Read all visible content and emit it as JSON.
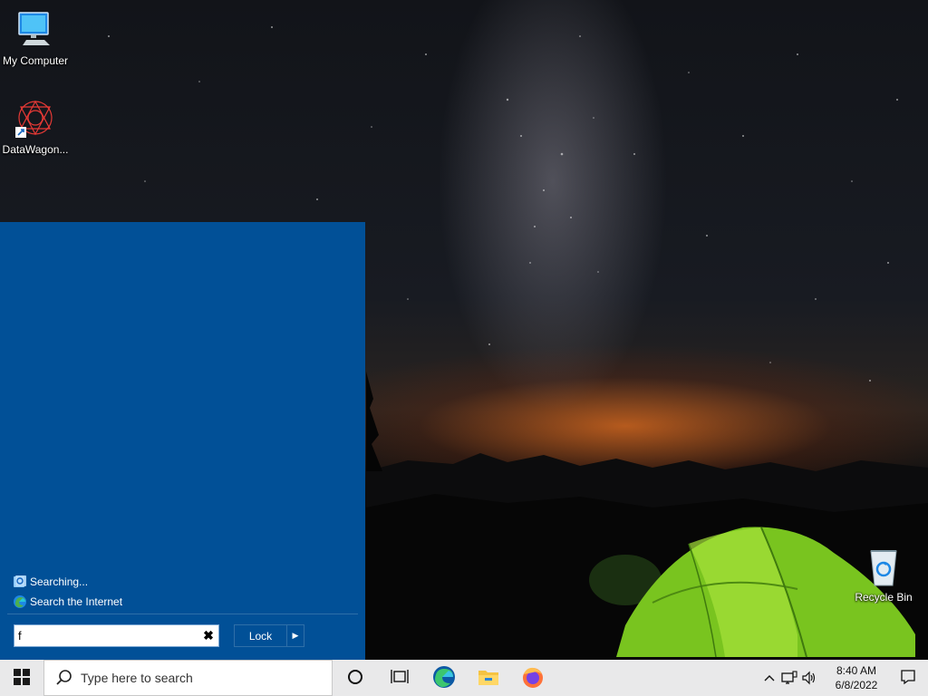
{
  "desktop": {
    "icons": [
      {
        "label": "My Computer",
        "icon": "computer-icon"
      },
      {
        "label": "DataWagon...",
        "icon": "datawagon-icon"
      },
      {
        "label": "Recycle Bin",
        "icon": "recycle-bin-icon"
      }
    ]
  },
  "start_menu": {
    "results": [
      {
        "label": "Searching...",
        "icon": "searching-icon"
      },
      {
        "label": "Search the Internet",
        "icon": "edge-icon"
      }
    ],
    "search": {
      "value": "f",
      "clear_icon": "close-icon"
    },
    "lock_label": "Lock",
    "lock_arrow_icon": "chevron-right-icon"
  },
  "taskbar": {
    "start_icon": "windows-icon",
    "search_placeholder": "Type here to search",
    "apps": [
      "cortana-icon",
      "task-view-icon",
      "edge-icon",
      "file-explorer-icon",
      "firefox-icon"
    ],
    "tray": [
      "chevron-up-icon",
      "network-icon",
      "volume-icon"
    ],
    "time": "8:40 AM",
    "date": "6/8/2022",
    "notification_icon": "notification-icon"
  },
  "colors": {
    "start_menu_bg": "#015097",
    "taskbar_bg": "#e9e9ea",
    "tent": "#7ed321"
  }
}
